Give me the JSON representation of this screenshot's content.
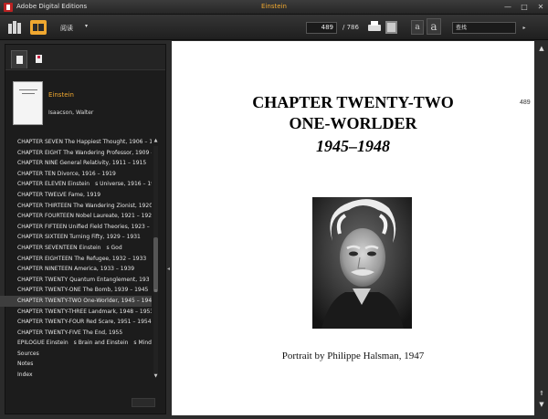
{
  "window": {
    "app_title": "Adobe Digital Editions",
    "doc_title": "Einstein",
    "minimize_glyph": "—",
    "maximize_glyph": "□",
    "close_glyph": "✕"
  },
  "toolbar": {
    "library_icon": "library-icon",
    "reading_icon": "reading-view-icon",
    "view_mode": "阅读",
    "view_mode_arrow": "▾",
    "current_page": "489",
    "total_pages": "/ 786",
    "print_icon": "print-icon",
    "fit_icon": "fit-page-icon",
    "font_smaller": "a",
    "font_larger": "a",
    "search_value": "查找",
    "search_go_glyph": "▸"
  },
  "sidebar": {
    "tabs": [
      {
        "icon": "bookmarks-icon",
        "active": true
      },
      {
        "icon": "annotations-icon",
        "active": false
      }
    ],
    "book": {
      "title": "Einstein",
      "author": "Isaacson, Walter"
    },
    "toc": [
      "CHAPTER SEVEN The Happiest Thought, 1906 – 1",
      "CHAPTER EIGHT The Wandering Professor, 1909 –",
      "CHAPTER NINE General Relativity, 1911 – 1915",
      "CHAPTER TEN Divorce, 1916 – 1919",
      "CHAPTER ELEVEN Einstein　s Universe, 1916 – 19",
      "CHAPTER TWELVE Fame, 1919",
      "CHAPTER THIRTEEN The Wandering Zionist, 1920",
      "CHAPTER FOURTEEN Nobel Laureate, 1921 – 1927",
      "CHAPTER FIFTEEN Unified Field Theories, 1923 – 1",
      "CHAPTER SIXTEEN Turning Fifty, 1929 – 1931",
      "CHAPTER SEVENTEEN Einstein　s God",
      "CHAPTER EIGHTEEN The Refugee, 1932 – 1933",
      "CHAPTER NINETEEN America, 1933 – 1939",
      "CHAPTER TWENTY Quantum Entanglement, 193",
      "CHAPTER TWENTY-ONE The Bomb, 1939 – 1945",
      "CHAPTER TWENTY-TWO One-Worlder, 1945 – 194",
      "CHAPTER TWENTY-THREE Landmark, 1948 – 1953",
      "CHAPTER TWENTY-FOUR Red Scare, 1951 – 1954",
      "CHAPTER TWENTY-FIVE The End, 1955",
      "EPILOGUE Einstein　s Brain and Einstein　s Mind",
      "Sources",
      "Notes",
      "Index"
    ],
    "selected_index": 15,
    "scroll_up_glyph": "▲",
    "scroll_down_glyph": "▼",
    "scroll_grip_glyph": "≡",
    "collapse_glyph": "◂"
  },
  "page": {
    "page_number": "489",
    "chapter_title": "CHAPTER TWENTY-TWO",
    "chapter_subtitle": "ONE-WORLDER",
    "chapter_years": "1945–1948",
    "caption": "Portrait by Philippe Halsman, 1947"
  },
  "page_scroll": {
    "up_glyph": "▲",
    "top_glyph": "⇑",
    "down_glyph": "▼"
  }
}
